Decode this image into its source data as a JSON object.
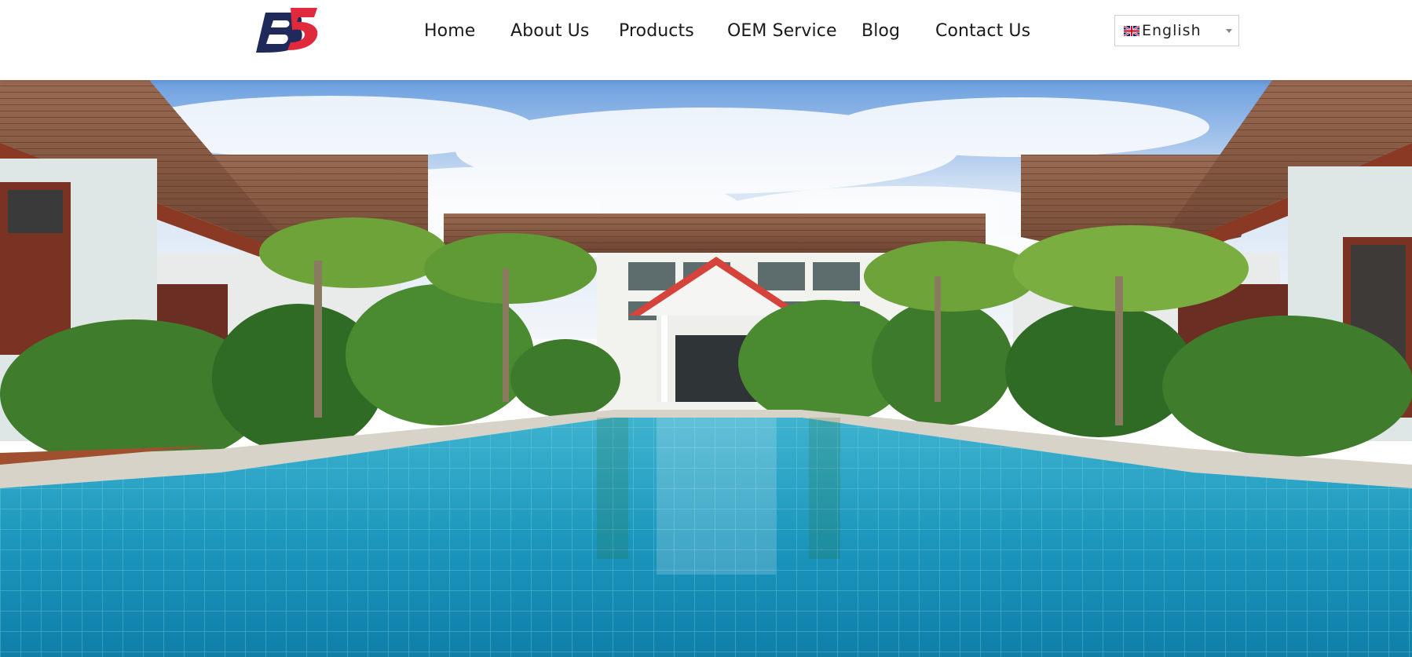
{
  "header": {
    "logo_name": "brand-logo",
    "nav": [
      {
        "label": "Home"
      },
      {
        "label": "About Us"
      },
      {
        "label": "Products"
      },
      {
        "label": "OEM Service"
      },
      {
        "label": "Blog"
      },
      {
        "label": "Contact Us"
      }
    ],
    "language": {
      "selected": "English",
      "flag_icon": "uk-flag-icon"
    }
  },
  "hero": {
    "image": "resort-pool-photo"
  },
  "colors": {
    "brand_navy": "#1f2a5a",
    "brand_red": "#e02a3c",
    "pool_blue": "#1fa3c4",
    "sky_blue": "#5b93d6"
  }
}
